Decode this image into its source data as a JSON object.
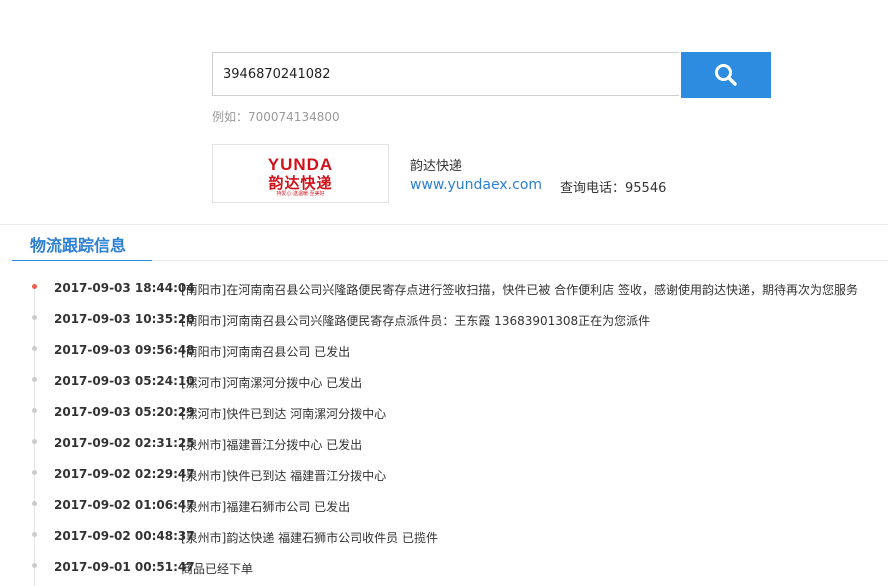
{
  "search": {
    "value": "3946870241082",
    "example_label": "例如：700074134800",
    "button_icon": "search-icon"
  },
  "company": {
    "logo_text": "YUNDA",
    "logo_text_cn": "韵达快递",
    "logo_slogan": "持爱心·送温暖·至美好",
    "name": "韵达快递",
    "website": "www.yundaex.com",
    "phone": "查询电话：95546",
    "brand_color": "#d0121b"
  },
  "tracking": {
    "title": "物流跟踪信息",
    "accent_color": "#2d8be0",
    "latest_dot_color": "#f25d4a",
    "entries": [
      {
        "time": "2017-09-03 18:44:04",
        "desc": "[南阳市]在河南南召县公司兴隆路便民寄存点进行签收扫描，快件已被 合作便利店 签收，感谢使用韵达快递，期待再次为您服务"
      },
      {
        "time": "2017-09-03 10:35:20",
        "desc": "[南阳市]河南南召县公司兴隆路便民寄存点派件员：王东霞 13683901308正在为您派件"
      },
      {
        "time": "2017-09-03 09:56:48",
        "desc": "[南阳市]河南南召县公司 已发出"
      },
      {
        "time": "2017-09-03 05:24:10",
        "desc": "[漯河市]河南漯河分拨中心 已发出"
      },
      {
        "time": "2017-09-03 05:20:29",
        "desc": "[漯河市]快件已到达 河南漯河分拨中心"
      },
      {
        "time": "2017-09-02 02:31:25",
        "desc": "[泉州市]福建晋江分拨中心 已发出"
      },
      {
        "time": "2017-09-02 02:29:47",
        "desc": "[泉州市]快件已到达 福建晋江分拨中心"
      },
      {
        "time": "2017-09-02 01:06:47",
        "desc": "[泉州市]福建石狮市公司 已发出"
      },
      {
        "time": "2017-09-02 00:48:37",
        "desc": "[泉州市]韵达快递 福建石狮市公司收件员 已揽件"
      },
      {
        "time": "2017-09-01 00:51:47",
        "desc": "商品已经下单"
      }
    ]
  }
}
